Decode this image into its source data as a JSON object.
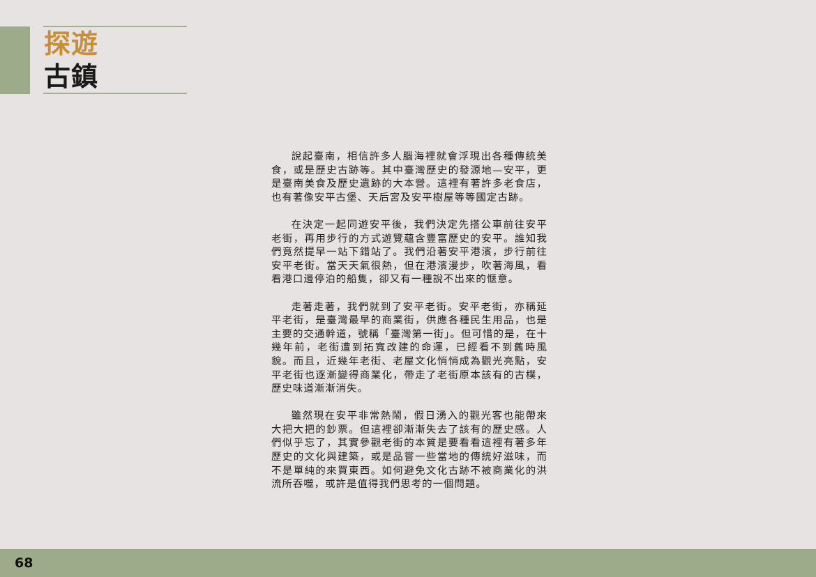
{
  "section": {
    "title_line1": "探遊",
    "title_line2": "古鎮",
    "accent_color": "#c88f3a",
    "band_color": "#9dab8b"
  },
  "article": {
    "paragraphs": [
      "說起臺南，相信許多人腦海裡就會浮現出各種傳統美食，或是歷史古跡等。其中臺灣歷史的發源地—安平，更是臺南美食及歷史遺跡的大本營。這裡有著許多老食店，也有著像安平古堡、天后宮及安平樹屋等等國定古跡。",
      "在決定一起同遊安平後，我們決定先搭公車前往安平老街，再用步行的方式遊覽蘊含豐富歷史的安平。誰知我們竟然提早一站下錯站了。我們沿著安平港濱，步行前往安平老街。當天天氣很熱，但在港濱漫步，吹著海風，看看港口邊停泊的船隻，卻又有一種說不出來的愜意。",
      "走著走著，我們就到了安平老街。安平老街，亦稱延平老街，是臺灣最早的商業街，供應各種民生用品，也是主要的交通幹道，號稱「臺灣第一街」。但可惜的是，在十幾年前，老街遭到拓寬改建的命運，已經看不到舊時風貌。而且，近幾年老街、老屋文化悄悄成為觀光亮點，安平老街也逐漸變得商業化，帶走了老街原本該有的古樸，歷史味道漸漸消失。",
      "雖然現在安平非常熱鬧，假日湧入的觀光客也能帶來大把大把的鈔票。但這裡卻漸漸失去了該有的歷史感。人們似乎忘了，其實參觀老街的本質是要看看這裡有著多年歷史的文化與建築，或是品嘗一些當地的傳統好滋味，而不是單純的來買東西。如何避免文化古跡不被商業化的洪流所吞噬，或許是值得我們思考的一個問題。"
    ]
  },
  "footer": {
    "page_number": "68"
  }
}
